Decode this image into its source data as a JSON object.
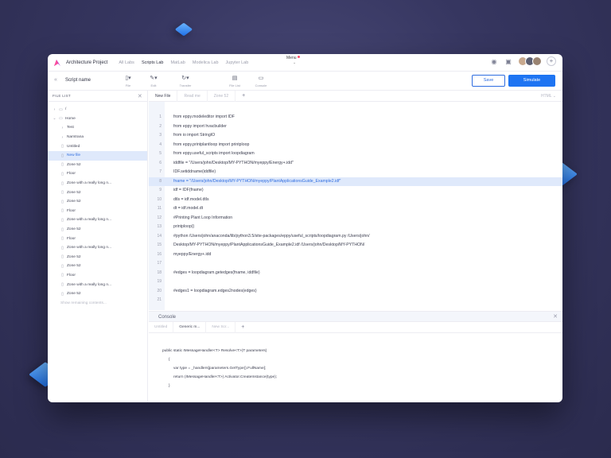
{
  "topbar": {
    "project": "Architecture Project",
    "nav": [
      "All Labs",
      "Scripts Lab",
      "MatLab",
      "Modelica Lab",
      "Jupyter Lab"
    ],
    "active_nav": "Scripts Lab",
    "menu_label": "Menu"
  },
  "toolbar": {
    "script_name": "Script name",
    "tools": [
      "File",
      "Edit",
      "Transfer",
      "File List",
      "Console"
    ],
    "save_label": "Save",
    "simulate_label": "Simulate"
  },
  "sidebar": {
    "title": "FILE LIST",
    "items": [
      {
        "label": "/",
        "icon": "folder-icon",
        "indent": 0
      },
      {
        "label": "Home",
        "icon": "folder-open-icon",
        "indent": 0
      },
      {
        "label": "Test",
        "icon": "chevron-right-icon",
        "indent": 1
      },
      {
        "label": "Namtrana",
        "icon": "chevron-right-icon",
        "indent": 1
      },
      {
        "label": "Untitled",
        "icon": "file-icon",
        "indent": 1
      },
      {
        "label": "New file",
        "icon": "file-icon",
        "indent": 1,
        "selected": true
      },
      {
        "label": "Zone 52",
        "icon": "file-icon",
        "indent": 1
      },
      {
        "label": "Floor",
        "icon": "file-icon",
        "indent": 1
      },
      {
        "label": "Zone with a really long n...",
        "icon": "file-icon",
        "indent": 1
      },
      {
        "label": "Zone 52",
        "icon": "file-icon",
        "indent": 1
      },
      {
        "label": "Zone 52",
        "icon": "file-icon",
        "indent": 1
      },
      {
        "label": "Floor",
        "icon": "file-icon",
        "indent": 1
      },
      {
        "label": "Zone with a really long n...",
        "icon": "file-icon",
        "indent": 1
      },
      {
        "label": "Zone 52",
        "icon": "file-icon",
        "indent": 1
      },
      {
        "label": "Floor",
        "icon": "file-icon",
        "indent": 1
      },
      {
        "label": "Zone with a really long n...",
        "icon": "file-icon",
        "indent": 1
      },
      {
        "label": "Zone 52",
        "icon": "file-icon",
        "indent": 1
      },
      {
        "label": "Zone 52",
        "icon": "file-icon",
        "indent": 1
      },
      {
        "label": "Floor",
        "icon": "file-icon",
        "indent": 1
      },
      {
        "label": "Zone with a really long n...",
        "icon": "file-icon",
        "indent": 1
      },
      {
        "label": "Zone 52",
        "icon": "file-icon",
        "indent": 1
      },
      {
        "label": "Show remaining contents...",
        "icon": "",
        "indent": 1,
        "muted": true
      }
    ]
  },
  "editor": {
    "tabs": [
      "New File",
      "Read me",
      "Zone 52"
    ],
    "active_tab": "New File",
    "language": "HTML",
    "highlight_line": 8,
    "lines": [
      "from eppy.modeleditor import IDF",
      "from eppy import hvacbuilder",
      "from io import StringIO",
      "from eppy.printplantloop import printploop",
      "from eppy.useful_scripts import loopdiagram",
      "iddfile = \"/Users/john/Desktop/MY-PYTHON/myeppy/Energy+.idd\"",
      "IDF.setiddname(iddfile)",
      "fname = \"/Users/john/Desktop/MY-PYTHON/myeppy/PlantApplicationsGuide_Example2.idf\"",
      "idf = IDF(fname)",
      "dtls = idf.model.dtls",
      "dt = idf.model.dt",
      "#Printing Plant Loop Information",
      "printploop()",
      "#python /Users/john/anaconda/lib/python3.5/site-packages/eppy/useful_scripts/loopdiagram.py /Users/john/",
      "Desktop/MY-PYTHON/myeppy/PlantApplicationsGuide_Example2.idf /Users/john/Desktop/MY-PYTHON/",
      "myeppy/Energy+.idd",
      "",
      "#edges = loopdiagram.getedges(fname, iddfile)",
      "",
      "#edges1 = loopdiagram.edges2nodes(edges)",
      ""
    ]
  },
  "console": {
    "title": "Console",
    "tabs": [
      "Untitled",
      "Generic m...",
      "New Scr..."
    ],
    "active_tab": "Generic m...",
    "lines": [
      "public static IMessageHandler<T> Resolve<T>(T parameters)",
      "{",
      "var type = _handlers[parameters.GetType().FullName];",
      "return (IMessageHandler<T>) Activator.CreateInstance(type);",
      "}"
    ]
  },
  "colors": {
    "accent": "#1e74f2",
    "highlight": "#dfe9fb",
    "background": "#363660"
  }
}
